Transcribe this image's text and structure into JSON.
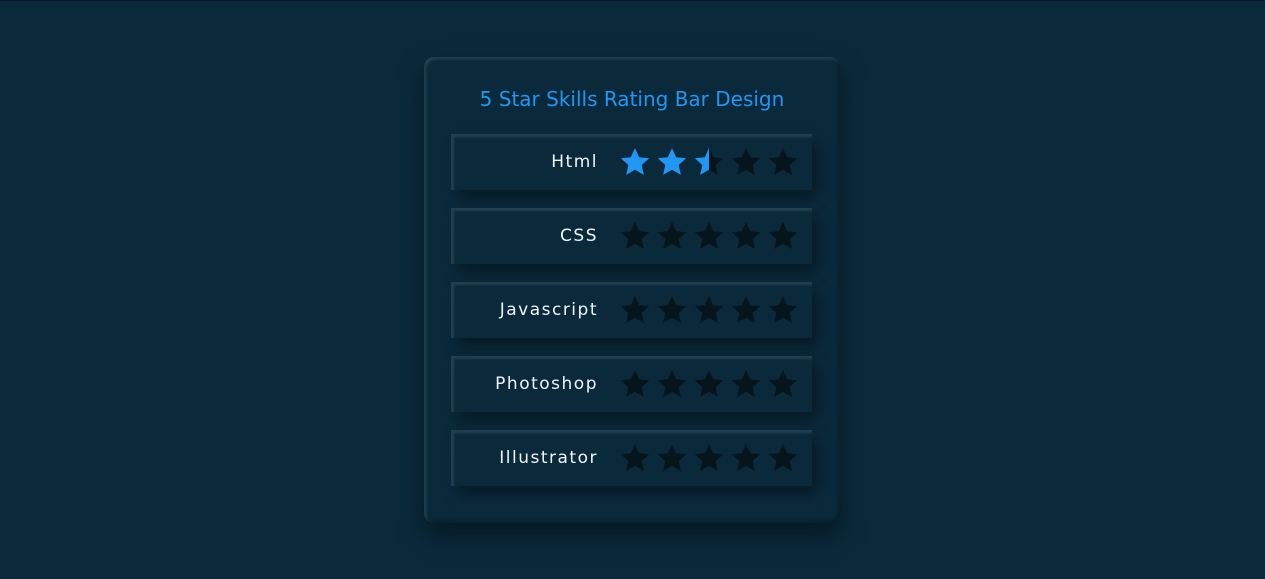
{
  "title": "5 Star Skills Rating Bar Design",
  "colors": {
    "accent": "#2196f3",
    "empty_star": "#06141c",
    "background": "#0a2a3c"
  },
  "max_rating": 5,
  "skills": [
    {
      "label": "Html",
      "rating": 2.5
    },
    {
      "label": "CSS",
      "rating": 0
    },
    {
      "label": "Javascript",
      "rating": 0
    },
    {
      "label": "Photoshop",
      "rating": 0
    },
    {
      "label": "Illustrator",
      "rating": 0
    }
  ]
}
